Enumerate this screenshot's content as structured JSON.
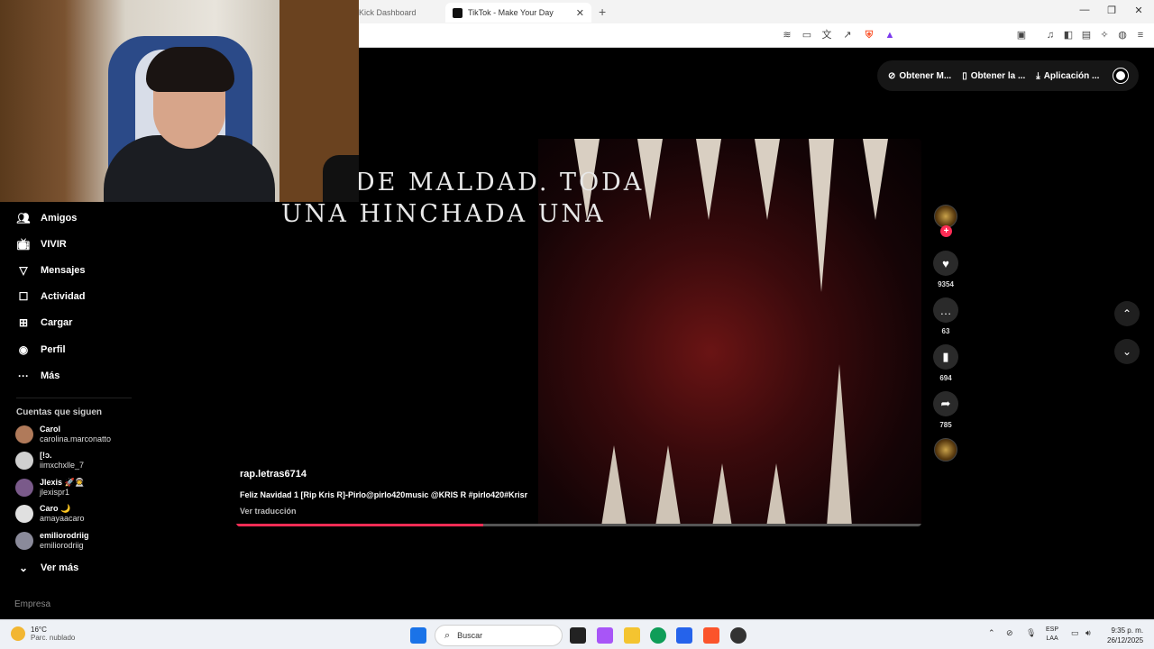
{
  "browser": {
    "tabs": [
      {
        "title": "Kick Dashboard",
        "active": false
      },
      {
        "title": "TikTok - Make Your Day",
        "active": true
      }
    ],
    "new_tab": "+",
    "window_controls": {
      "minimize": "—",
      "restore": "❐",
      "close": "✕"
    }
  },
  "topbar": {
    "buttons": [
      "Obtener M...",
      "Obtener la ...",
      "Aplicación ..."
    ]
  },
  "sidebar": {
    "items": [
      {
        "label": "Amigos",
        "icon": "friends-icon"
      },
      {
        "label": "VIVIR",
        "icon": "live-icon"
      },
      {
        "label": "Mensajes",
        "icon": "messages-icon"
      },
      {
        "label": "Actividad",
        "icon": "activity-icon"
      },
      {
        "label": "Cargar",
        "icon": "upload-icon"
      },
      {
        "label": "Perfil",
        "icon": "profile-icon"
      },
      {
        "label": "Más",
        "icon": "more-icon"
      }
    ],
    "following_title": "Cuentas que siguen",
    "accounts": [
      {
        "name": "Carol",
        "handle": "carolina.marconatto",
        "color": "#b07a5a"
      },
      {
        "name": "[!ɔ.",
        "handle": "iimxchxlle_7",
        "color": "#d0d0d0"
      },
      {
        "name": "Jlexis 🚀👨‍🚀",
        "handle": "jlexispr1",
        "color": "#7a5a8a"
      },
      {
        "name": "Caro 🌙",
        "handle": "amayaacaro",
        "color": "#e0e0e0"
      },
      {
        "name": "emiliorodriig",
        "handle": "emiliorodriig",
        "color": "#8a8a9a"
      }
    ],
    "see_more": "Ver más",
    "footer": "Empresa"
  },
  "video": {
    "lyric_line1": "DE MALDAD. TODA",
    "lyric_line2": "UNA HINCHADA UNA",
    "author": "rap.letras6714",
    "caption": "Feliz Navidad 1 [Rip Kris R]-Pirlo@pirlo420music @KRIS R #pirlo420#Krisr",
    "see_translation": "Ver traducción",
    "progress": 0.36
  },
  "actions": {
    "likes": "9354",
    "comments": "63",
    "saves": "694",
    "shares": "785"
  },
  "taskbar": {
    "temp": "16°C",
    "weather": "Parc. nublado",
    "search_placeholder": "Buscar",
    "lang_top": "ESP",
    "lang_bottom": "LAA",
    "time": "9:35 p. m.",
    "date": "26/12/2025"
  }
}
